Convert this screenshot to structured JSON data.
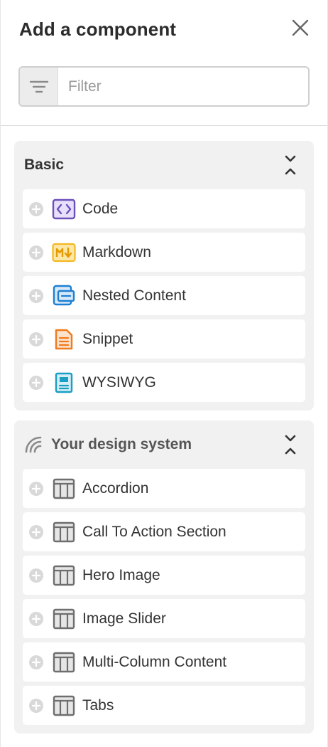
{
  "header": {
    "title": "Add a component",
    "close_icon": "close-icon"
  },
  "filter": {
    "placeholder": "Filter",
    "value": "",
    "icon": "filter-icon"
  },
  "groups": [
    {
      "title": "Basic",
      "collapse_icon": "collapse-icon",
      "items": [
        {
          "label": "Code",
          "icon": "code-icon",
          "color": "#6b4fbb"
        },
        {
          "label": "Markdown",
          "icon": "markdown-icon",
          "color": "#f2b824"
        },
        {
          "label": "Nested Content",
          "icon": "nested-content-icon",
          "color": "#1e7fd0"
        },
        {
          "label": "Snippet",
          "icon": "snippet-icon",
          "color": "#f07a1c"
        },
        {
          "label": "WYSIWYG",
          "icon": "wysiwyg-icon",
          "color": "#1b9ec3"
        }
      ]
    },
    {
      "title": "Your design system",
      "source_icon": "design-system-icon",
      "collapse_icon": "collapse-icon",
      "items": [
        {
          "label": "Accordion",
          "icon": "component-icon",
          "color": "#6e6e6e"
        },
        {
          "label": "Call To Action Section",
          "icon": "component-icon",
          "color": "#6e6e6e"
        },
        {
          "label": "Hero Image",
          "icon": "component-icon",
          "color": "#6e6e6e"
        },
        {
          "label": "Image Slider",
          "icon": "component-icon",
          "color": "#6e6e6e"
        },
        {
          "label": "Multi-Column Content",
          "icon": "component-icon",
          "color": "#6e6e6e"
        },
        {
          "label": "Tabs",
          "icon": "component-icon",
          "color": "#6e6e6e"
        }
      ]
    }
  ]
}
